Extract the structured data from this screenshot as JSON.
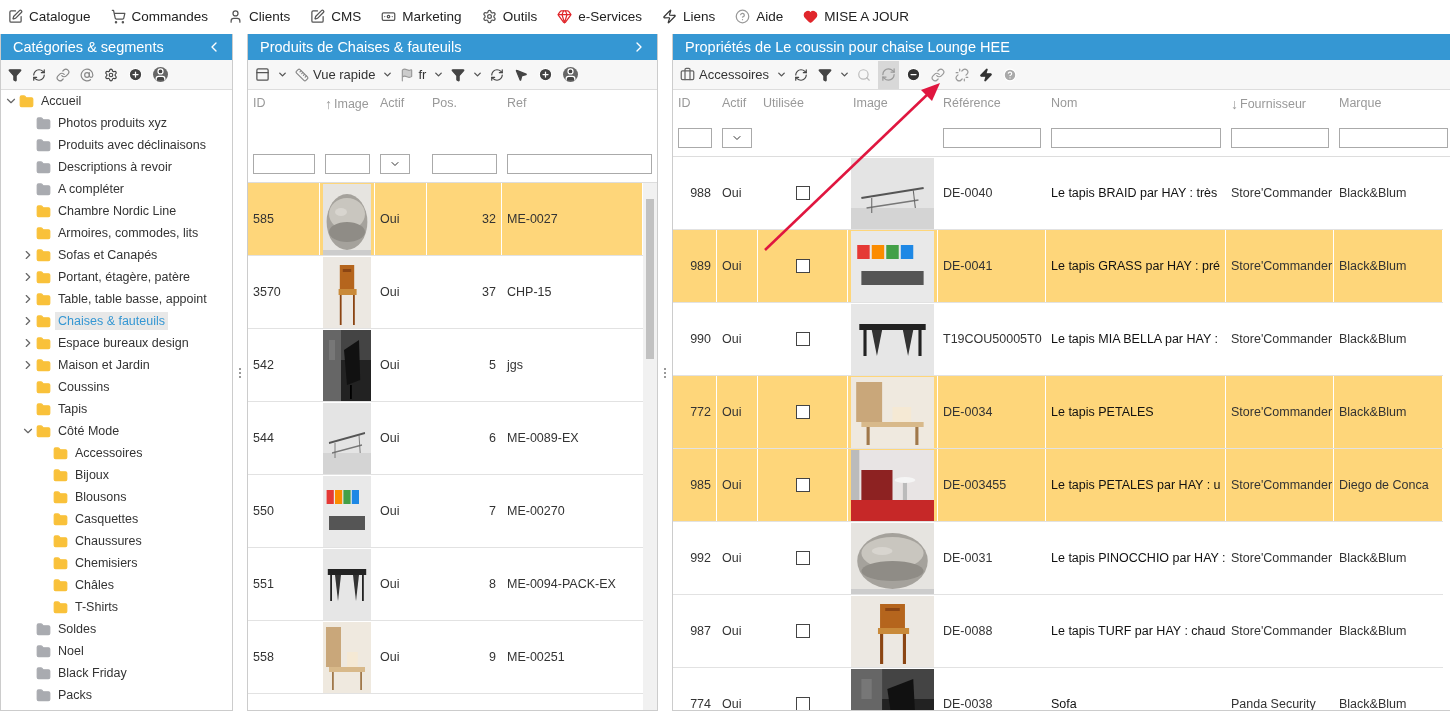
{
  "menu": [
    {
      "label": "Catalogue"
    },
    {
      "label": "Commandes"
    },
    {
      "label": "Clients"
    },
    {
      "label": "CMS"
    },
    {
      "label": "Marketing"
    },
    {
      "label": "Outils"
    },
    {
      "label": "e-Services"
    },
    {
      "label": "Liens"
    },
    {
      "label": "Aide"
    },
    {
      "label": "MISE A JOUR"
    }
  ],
  "categories": {
    "title": "Catégories & segments",
    "tree": [
      {
        "label": "Accueil",
        "color": "#f9c13a",
        "expanded": true,
        "selected": false,
        "children": [
          {
            "label": "Photos produits xyz",
            "color": "#a9abb0",
            "selected": false
          },
          {
            "label": "Produits avec déclinaisons",
            "color": "#a9abb0",
            "selected": false
          },
          {
            "label": "Descriptions à revoir",
            "color": "#a9abb0",
            "selected": false
          },
          {
            "label": "A compléter",
            "color": "#a9abb0",
            "selected": false
          },
          {
            "label": "Chambre Nordic Line",
            "color": "#f9c13a",
            "selected": false
          },
          {
            "label": "Armoires, commodes, lits",
            "color": "#f9c13a",
            "selected": false
          },
          {
            "label": "Sofas et Canapés",
            "color": "#f9c13a",
            "expanded": false,
            "selected": false
          },
          {
            "label": "Portant, étagère, patère",
            "color": "#f9c13a",
            "expanded": false,
            "selected": false
          },
          {
            "label": "Table, table basse, appoint",
            "color": "#f9c13a",
            "expanded": false,
            "selected": false
          },
          {
            "label": "Chaises & fauteuils",
            "color": "#f9c13a",
            "expanded": false,
            "selected": true
          },
          {
            "label": "Espace bureaux design",
            "color": "#f9c13a",
            "expanded": false,
            "selected": false
          },
          {
            "label": "Maison et Jardin",
            "color": "#f9c13a",
            "expanded": false,
            "selected": false
          },
          {
            "label": "Coussins",
            "color": "#f9c13a",
            "selected": false
          },
          {
            "label": "Tapis",
            "color": "#f9c13a",
            "selected": false
          },
          {
            "label": "Côté Mode",
            "color": "#f9c13a",
            "expanded": true,
            "selected": false,
            "children": [
              {
                "label": "Accessoires",
                "color": "#f9c13a",
                "selected": false
              },
              {
                "label": "Bijoux",
                "color": "#f9c13a",
                "selected": false
              },
              {
                "label": "Blousons",
                "color": "#f9c13a",
                "selected": false
              },
              {
                "label": "Casquettes",
                "color": "#f9c13a",
                "selected": false
              },
              {
                "label": "Chaussures",
                "color": "#f9c13a",
                "selected": false
              },
              {
                "label": "Chemisiers",
                "color": "#f9c13a",
                "selected": false
              },
              {
                "label": "Châles",
                "color": "#f9c13a",
                "selected": false
              },
              {
                "label": "T-Shirts",
                "color": "#f9c13a",
                "selected": false
              }
            ]
          },
          {
            "label": "Soldes",
            "color": "#a9abb0",
            "selected": false
          },
          {
            "label": "Noel",
            "color": "#a9abb0",
            "selected": false
          },
          {
            "label": "Black Friday",
            "color": "#a9abb0",
            "selected": false
          },
          {
            "label": "Packs",
            "color": "#a9abb0",
            "selected": false
          }
        ]
      }
    ]
  },
  "products": {
    "title": "Produits de Chaises & fauteuils",
    "toolbar": {
      "view": "Vue rapide",
      "language": "fr"
    },
    "columns": [
      {
        "label": "ID",
        "kind": "text"
      },
      {
        "label": "Image",
        "sort_arrow": "↑",
        "kind": "text"
      },
      {
        "label": "Actif",
        "kind": "select"
      },
      {
        "label": "Pos.",
        "kind": "text"
      },
      {
        "label": "Ref",
        "kind": "text"
      }
    ],
    "rows": [
      {
        "selected": true,
        "cells": [
          "585",
          "",
          "Oui",
          "32",
          "ME-0027"
        ]
      },
      {
        "selected": false,
        "cells": [
          "3570",
          "",
          "Oui",
          "37",
          "CHP-15"
        ]
      },
      {
        "selected": false,
        "cells": [
          "542",
          "",
          "Oui",
          "5",
          "jgs"
        ]
      },
      {
        "selected": false,
        "cells": [
          "544",
          "",
          "Oui",
          "6",
          "ME-0089-EX"
        ]
      },
      {
        "selected": false,
        "cells": [
          "550",
          "",
          "Oui",
          "7",
          "ME-00270"
        ]
      },
      {
        "selected": false,
        "cells": [
          "551",
          "",
          "Oui",
          "8",
          "ME-0094-PACK-EX"
        ]
      },
      {
        "selected": false,
        "cells": [
          "558",
          "",
          "Oui",
          "9",
          "ME-00251"
        ]
      }
    ]
  },
  "properties": {
    "title": "Propriétés de Le coussin pour chaise Lounge HEE",
    "toolbar": {
      "category": "Accessoires",
      "sync_pressed": true
    },
    "columns": [
      {
        "label": "ID",
        "kind": "text"
      },
      {
        "label": "Actif",
        "kind": "select"
      },
      {
        "label": "Utilisée",
        "kind": "none"
      },
      {
        "label": "Image",
        "kind": "none"
      },
      {
        "label": "Référence",
        "kind": "text"
      },
      {
        "label": "Nom",
        "kind": "text"
      },
      {
        "label": "Fournisseur",
        "sort_arrow": "↓",
        "kind": "text"
      },
      {
        "label": "Marque",
        "kind": "text"
      }
    ],
    "rows": [
      {
        "selected": false,
        "id": "988",
        "active": "Oui",
        "used": false,
        "ref": "DE-0040",
        "name": "Le tapis BRAID par HAY : très",
        "supplier": "Store'Commander",
        "brand": "Black&Blum"
      },
      {
        "selected": true,
        "id": "989",
        "active": "Oui",
        "used": false,
        "ref": "DE-0041",
        "name": "Le tapis GRASS par HAY : pré",
        "supplier": "Store'Commander",
        "brand": "Black&Blum"
      },
      {
        "selected": false,
        "id": "990",
        "active": "Oui",
        "used": false,
        "ref": "T19COU50005T0",
        "name": "Le tapis MIA BELLA par HAY :",
        "supplier": "Store'Commander",
        "brand": "Black&Blum"
      },
      {
        "selected": true,
        "id": "772",
        "active": "Oui",
        "used": false,
        "ref": "DE-0034",
        "name": "Le tapis PETALES",
        "supplier": "Store'Commander",
        "brand": "Black&Blum"
      },
      {
        "selected": true,
        "id": "985",
        "active": "Oui",
        "used": false,
        "ref": "DE-003455",
        "name": "Le tapis PETALES par HAY : u",
        "supplier": "Store'Commander",
        "brand": "Diego de Conca"
      },
      {
        "selected": false,
        "id": "992",
        "active": "Oui",
        "used": false,
        "ref": "DE-0031",
        "name": "Le tapis PINOCCHIO par HAY :",
        "supplier": "Store'Commander",
        "brand": "Black&Blum"
      },
      {
        "selected": false,
        "id": "987",
        "active": "Oui",
        "used": false,
        "ref": "DE-0088",
        "name": "Le tapis TURF par HAY : chaud",
        "supplier": "Store'Commander",
        "brand": "Black&Blum"
      },
      {
        "selected": false,
        "id": "774",
        "active": "Oui",
        "used": false,
        "ref": "DE-0038",
        "name": "Sofa",
        "supplier": "Panda Security",
        "brand": "Black&Blum"
      }
    ]
  }
}
